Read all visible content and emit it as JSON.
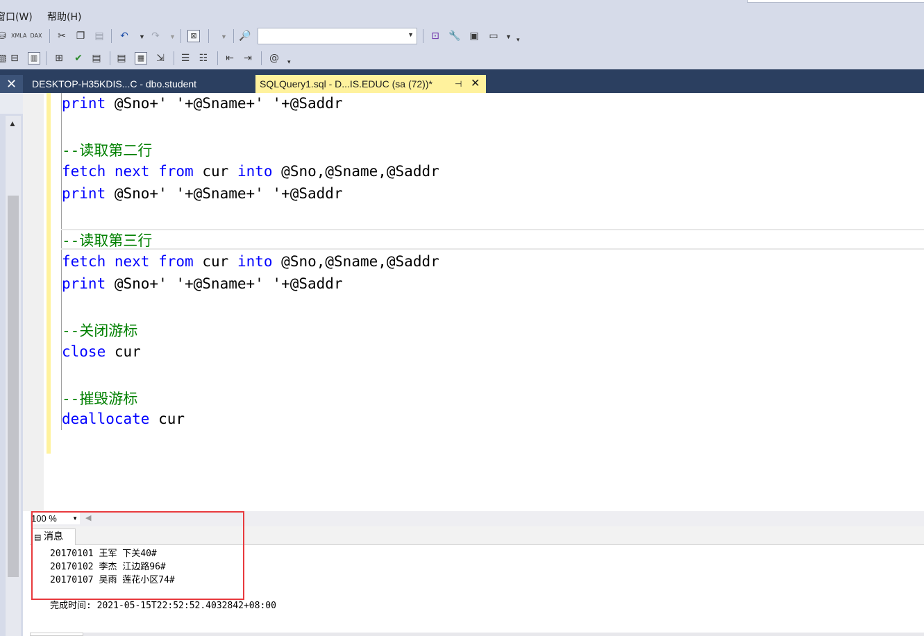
{
  "menu": {
    "window": "窗口(W)",
    "help": "帮助(H)"
  },
  "toolbar": {
    "xmla_label": "XMLA",
    "dax_label": "DAX",
    "database_combo_value": ""
  },
  "tabs": {
    "student_tab": "DESKTOP-H35KDIS...C - dbo.student",
    "query_tab": "SQLQuery1.sql - D...IS.EDUC (sa (72))*"
  },
  "editor": {
    "print1": "print",
    "print1_rest": " @Sno+' '+@Sname+' '+@Saddr",
    "comment_row2": "--读取第二行",
    "fetch2": "fetch next from cur into @Sno,@Sname,@Saddr",
    "print2": "print",
    "print2_rest": " @Sno+' '+@Sname+' '+@Saddr",
    "comment_row3": "--读取第三行",
    "fetch3": "fetch next from cur into @Sno,@Sname,@Saddr",
    "print3": "print",
    "print3_rest": " @Sno+' '+@Sname+' '+@Saddr",
    "comment_close": "--关闭游标",
    "close_kw": "close",
    "close_rest": " cur",
    "comment_dealloc": "--摧毁游标",
    "dealloc_kw": "deallocate",
    "dealloc_rest": " cur"
  },
  "zoom": {
    "value": "100 %"
  },
  "messages": {
    "tab_label": "消息",
    "lines": [
      "20170101 王军 下关40#",
      "20170102 李杰 江边路96#",
      "20170107 吴雨 莲花小区74#"
    ],
    "completion": "完成时间: 2021-05-15T22:52:52.4032842+08:00"
  },
  "colors": {
    "chrome": "#d6dbe9",
    "tab_strip": "#2b3f60",
    "active_tab": "#fff29d",
    "keyword": "#0000ff",
    "comment": "#008000",
    "highlight_box": "#e8393d"
  }
}
